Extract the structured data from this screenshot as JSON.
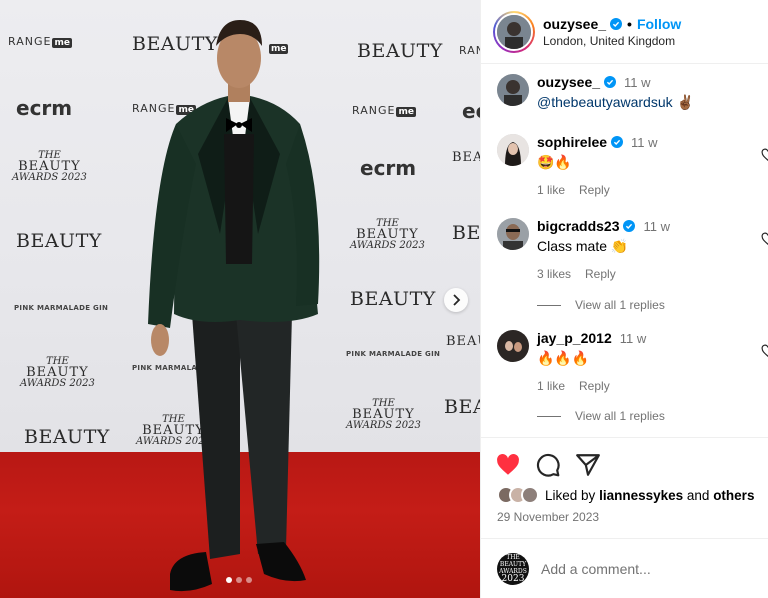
{
  "photo": {
    "backdrop_logos": {
      "range": "RANGE",
      "range_me": "me",
      "beauty": "BEAUTY",
      "ecrm": "ecrm",
      "awards_the": "THE",
      "awards_beauty": "BEAUTY",
      "awards_year": "AWARDS 2023",
      "gin": "PINK MARMALADE GIN"
    },
    "carousel_dots": 3,
    "active_dot": 0
  },
  "header": {
    "username": "ouzysee_",
    "separator": "•",
    "follow_label": "Follow",
    "location": "London, United Kingdom"
  },
  "caption": {
    "username": "ouzysee_",
    "time": "11 w",
    "mention": "@thebeautyawardsuk",
    "emoji": "✌🏾"
  },
  "comments": [
    {
      "username": "sophirelee",
      "verified": true,
      "time": "11 w",
      "text": "🤩🔥",
      "likes": "1 like",
      "reply": "Reply"
    },
    {
      "username": "bigcradds23",
      "verified": true,
      "time": "11 w",
      "text": "Class mate 👏",
      "likes": "3 likes",
      "reply": "Reply",
      "view_replies": "View all 1 replies"
    },
    {
      "username": "jay_p_2012",
      "verified": false,
      "time": "11 w",
      "text": "🔥🔥🔥",
      "likes": "1 like",
      "reply": "Reply",
      "view_replies": "View all 1 replies"
    }
  ],
  "likes": {
    "prefix": "Liked by",
    "user": "liannessykes",
    "and": "and",
    "others": "others"
  },
  "date": "29 November 2023",
  "add_comment": {
    "placeholder": "Add a comment...",
    "brand_the": "THE",
    "brand_beauty": "BEAUTY",
    "brand_awards": "AWARDS",
    "brand_year": "2023"
  },
  "colors": {
    "verified": "#0095f6",
    "follow": "#0095f6",
    "like_heart": "#ff3040",
    "carpet": "#c41d17"
  },
  "icons": {
    "like": "heart-icon",
    "comment": "comment-bubble-icon",
    "share": "paper-plane-icon",
    "next": "chevron-right-icon"
  }
}
